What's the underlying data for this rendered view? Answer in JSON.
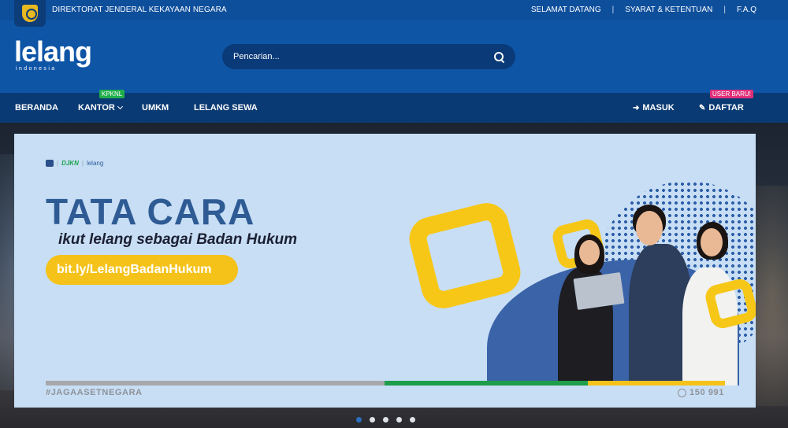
{
  "topbar": {
    "org_name": "DIREKTORAT JENDERAL KEKAYAAN NEGARA",
    "links": [
      "SELAMAT DATANG",
      "SYARAT & KETENTUAN",
      "F.A.Q"
    ]
  },
  "header": {
    "logo_word": "lelang",
    "logo_sub": "indonesia",
    "search_placeholder": "Pencarian..."
  },
  "nav": {
    "beranda": "BERANDA",
    "kantor": "KANTOR",
    "kantor_badge": "KPKNL",
    "umkm": "UMKM",
    "lelang_sewa": "LELANG SEWA",
    "masuk": "MASUK",
    "daftar": "DAFTAR",
    "daftar_badge": "USER BARU!"
  },
  "banner": {
    "brand_djkn": "DJKN",
    "brand_sep": "|",
    "brand_lelang": "lelang",
    "title": "TATA CARA",
    "subtitle": "ikut lelang sebagai Badan Hukum",
    "cta": "bit.ly/LelangBadanHukum",
    "hashtag": "#JAGAASETNEGARA",
    "phone": "150 991"
  },
  "carousel": {
    "count": 5,
    "active": 0
  },
  "colors": {
    "topbar": "#0e4f9c",
    "header": "#0e55a6",
    "nav": "#0a3a73",
    "accent_yellow": "#f5c21a",
    "accent_green": "#1fae4b",
    "accent_pink": "#e0307a"
  }
}
